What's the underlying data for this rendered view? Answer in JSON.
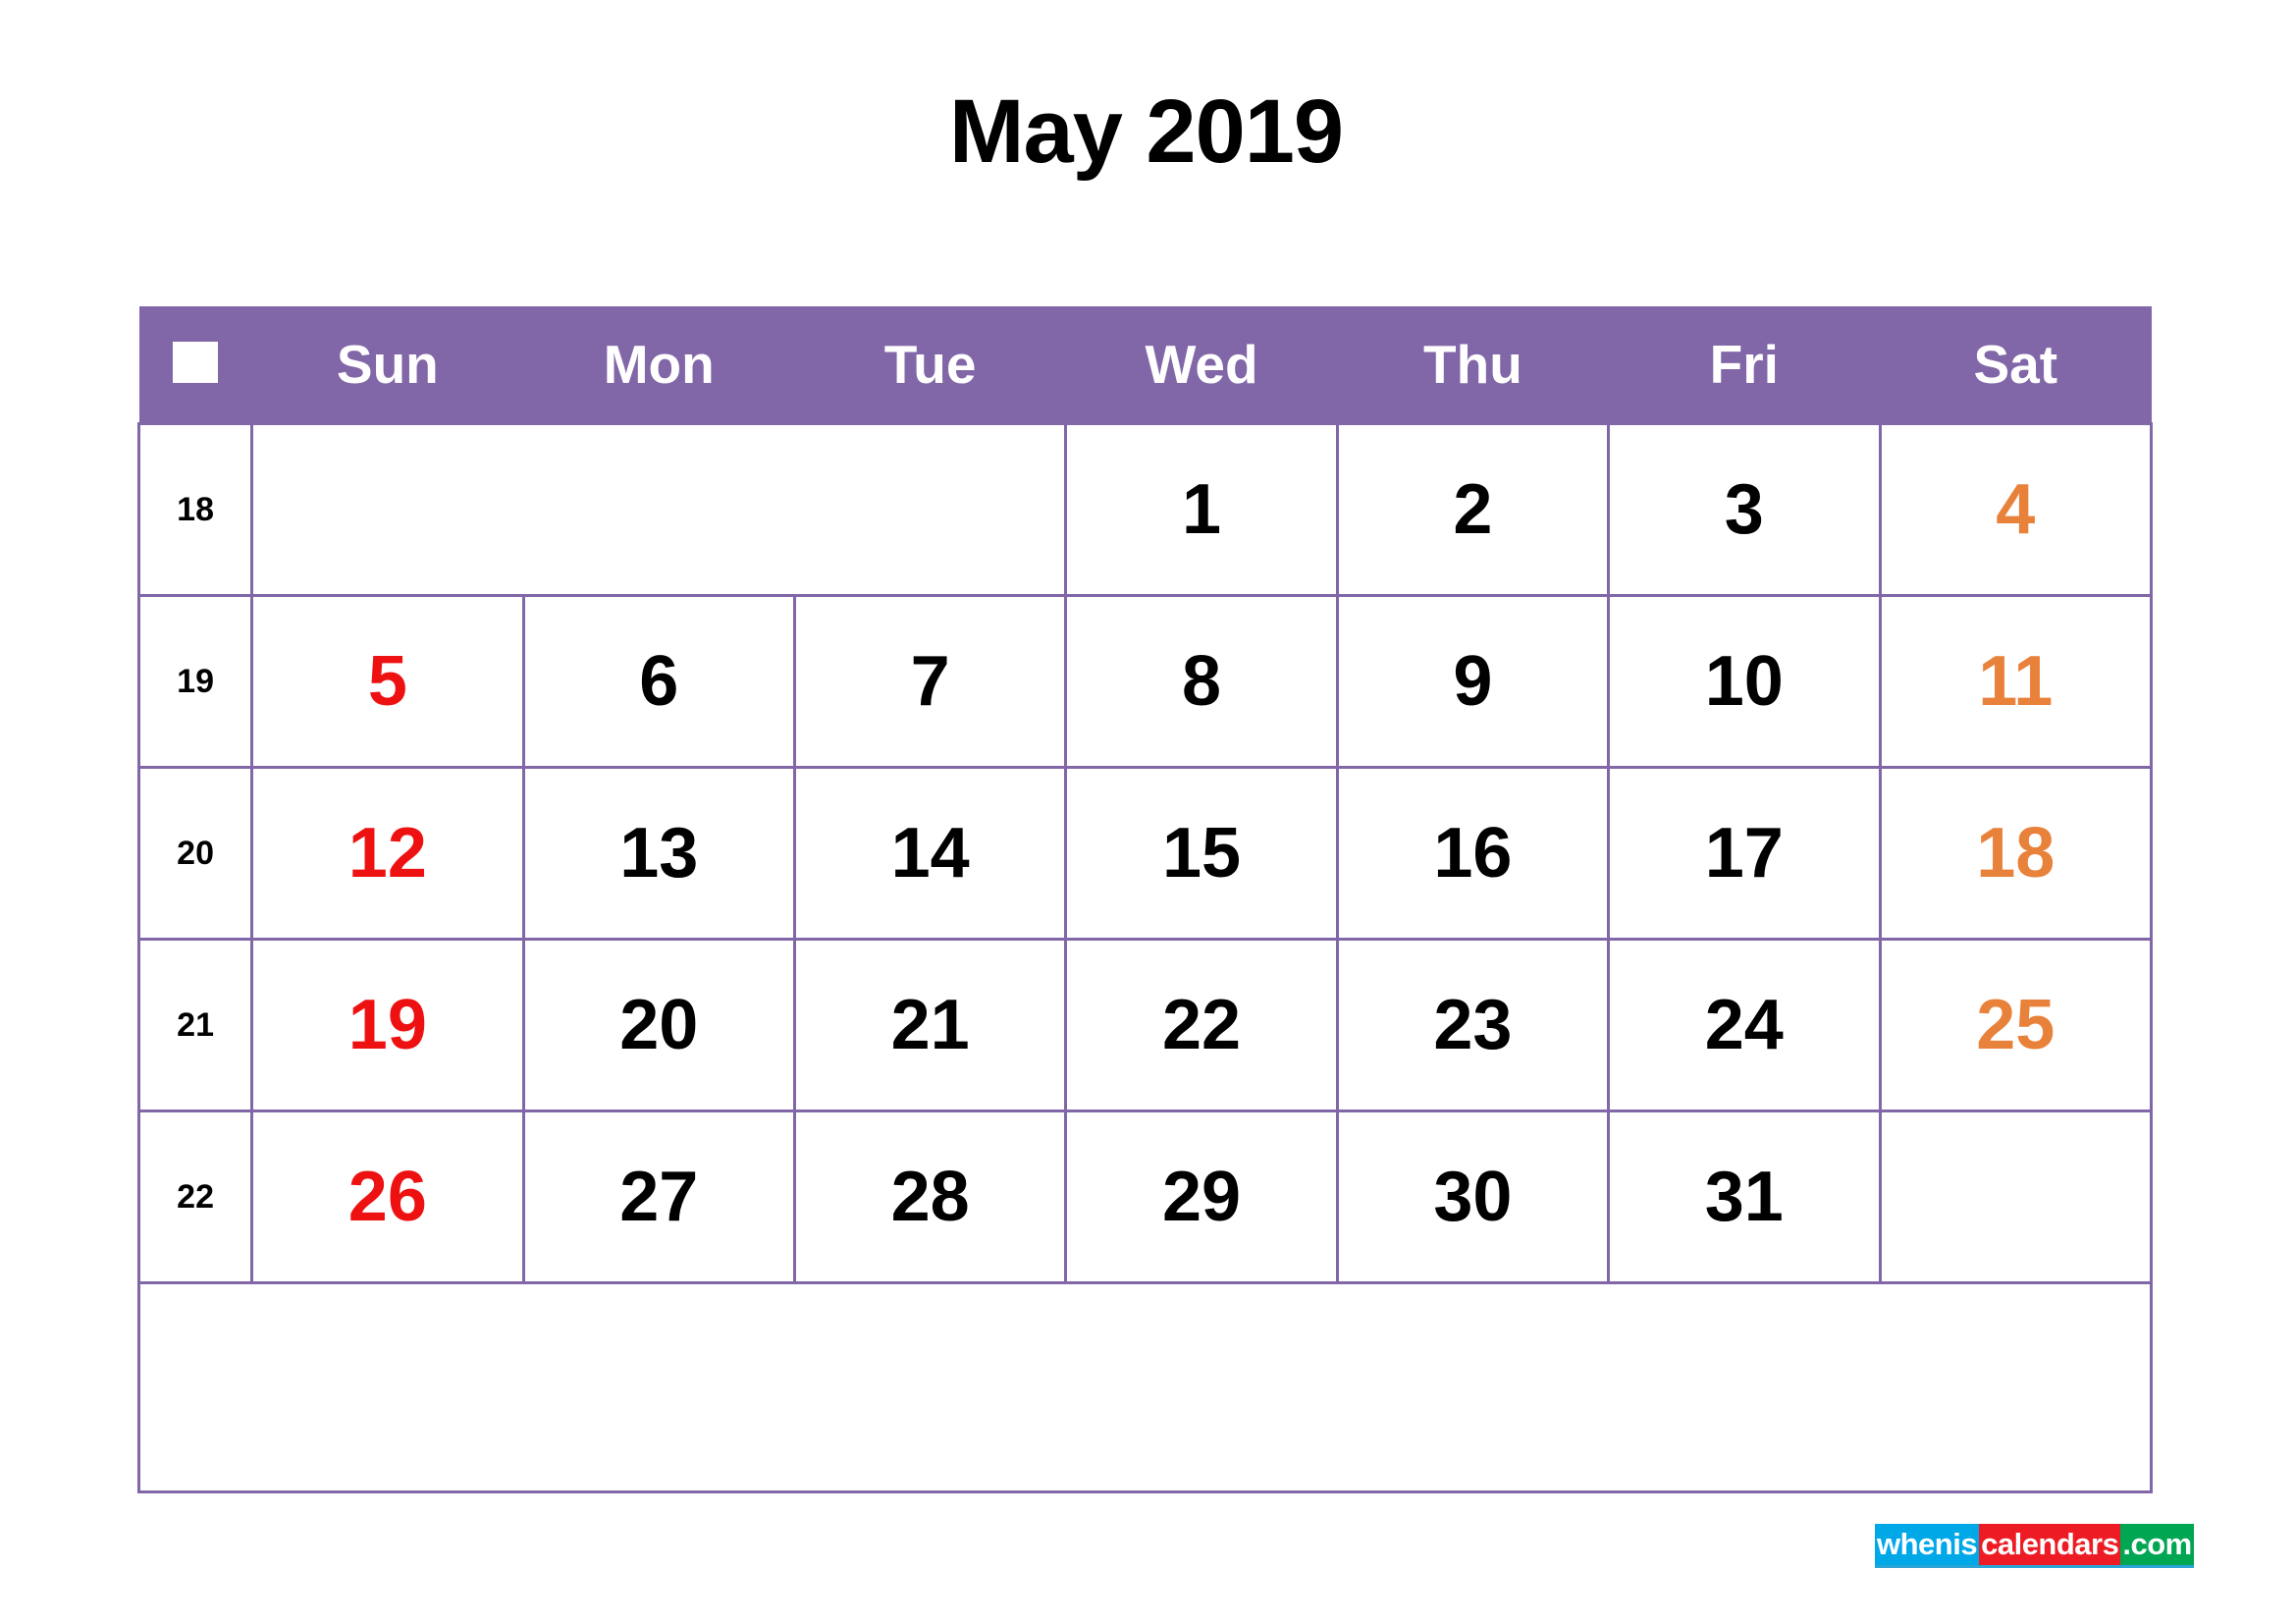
{
  "title": "May 2019",
  "colors": {
    "header_bg": "#8167A8",
    "border": "#8167A8",
    "sunday": "#EE1111",
    "saturday": "#E8813A",
    "weekday": "#000000",
    "logo_blue": "#00A8E8",
    "logo_red": "#ED1C24",
    "logo_green": "#00A651"
  },
  "header": {
    "week_col_icon": "white-square-icon",
    "days": [
      "Sun",
      "Mon",
      "Tue",
      "Wed",
      "Thu",
      "Fri",
      "Sat"
    ]
  },
  "weeks": [
    {
      "number": "18",
      "days": [
        "",
        "",
        "",
        "1",
        "2",
        "3",
        "4"
      ]
    },
    {
      "number": "19",
      "days": [
        "5",
        "6",
        "7",
        "8",
        "9",
        "10",
        "11"
      ]
    },
    {
      "number": "20",
      "days": [
        "12",
        "13",
        "14",
        "15",
        "16",
        "17",
        "18"
      ]
    },
    {
      "number": "21",
      "days": [
        "19",
        "20",
        "21",
        "22",
        "23",
        "24",
        "25"
      ]
    },
    {
      "number": "22",
      "days": [
        "26",
        "27",
        "28",
        "29",
        "30",
        "31",
        ""
      ]
    }
  ],
  "logo": {
    "part1": "whenis",
    "part2": "calendars",
    "part3": ".com"
  }
}
